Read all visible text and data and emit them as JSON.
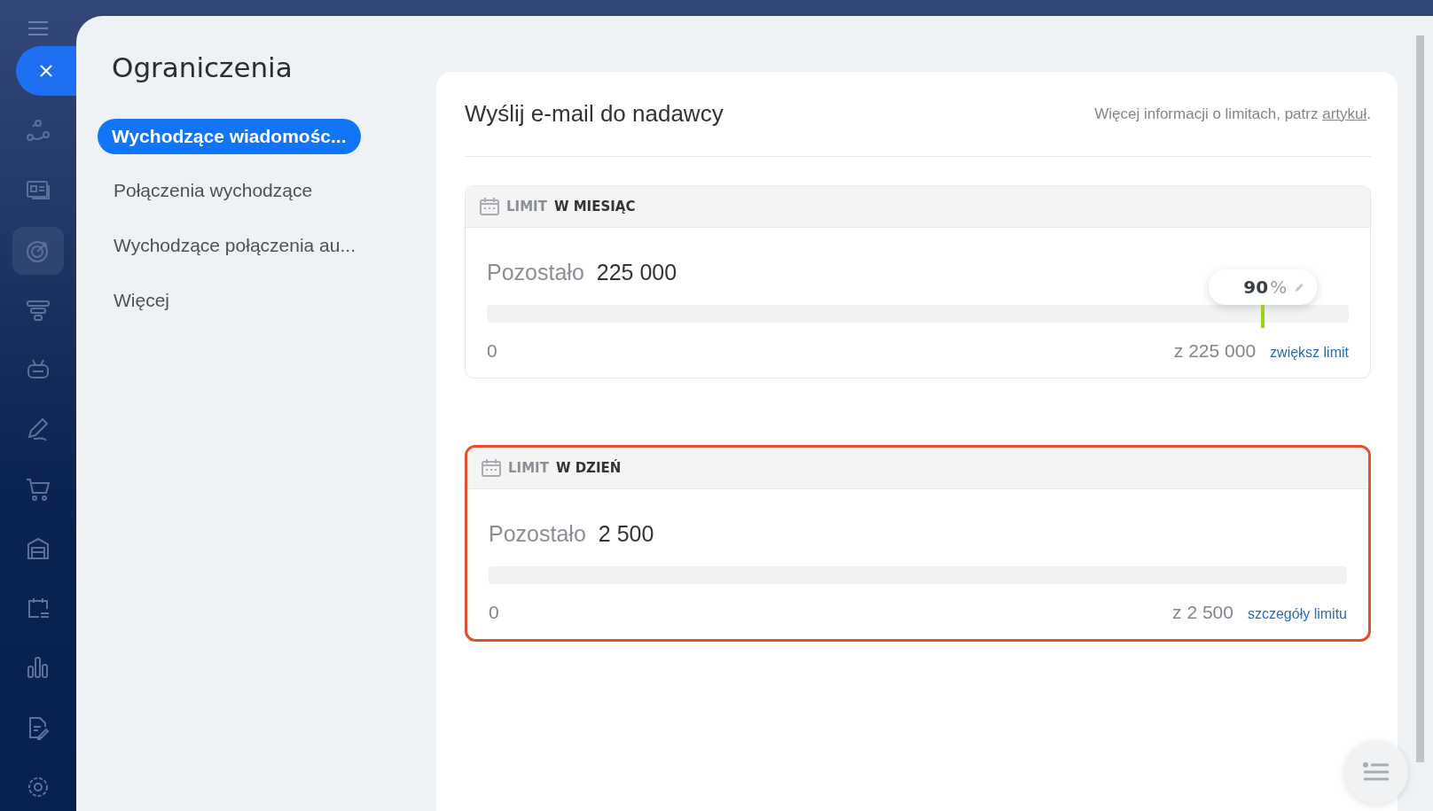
{
  "rail": {
    "icons": [
      {
        "kind": "menu",
        "selected": false
      },
      {
        "kind": "nodes",
        "selected": false
      },
      {
        "kind": "card",
        "selected": false
      },
      {
        "kind": "target",
        "selected": true
      },
      {
        "kind": "funnel",
        "selected": false
      },
      {
        "kind": "robot",
        "selected": false
      },
      {
        "kind": "pen",
        "selected": false
      },
      {
        "kind": "cart",
        "selected": false
      },
      {
        "kind": "garage",
        "selected": false
      },
      {
        "kind": "calendar",
        "selected": false
      },
      {
        "kind": "bars",
        "selected": false
      },
      {
        "kind": "doc",
        "selected": false
      },
      {
        "kind": "gear",
        "selected": false
      }
    ]
  },
  "panel": {
    "title": "Ograniczenia",
    "nav": [
      {
        "label": "Wychodzące wiadomośc...",
        "selected": true
      },
      {
        "label": "Połączenia wychodzące",
        "selected": false
      },
      {
        "label": "Wychodzące połączenia au...",
        "selected": false
      },
      {
        "label": "Więcej",
        "selected": false
      }
    ]
  },
  "content": {
    "title": "Wyślij e-mail do nadawcy",
    "info": "Więcej informacji o limitach, patrz",
    "info_link": "artykuł",
    "info_end": ".",
    "limits": [
      {
        "prefix": "LIMIT",
        "period": "W MIESIĄC",
        "highlighted": false,
        "remaining_label": "Pozostało",
        "remaining": "225 000",
        "min": "0",
        "max": "z 225 000",
        "link": "zwiększ limit",
        "threshold": {
          "level": 0.9,
          "value": "90",
          "unit": "%"
        }
      },
      {
        "prefix": "LIMIT",
        "period": "W DZIEŃ",
        "highlighted": true,
        "remaining_label": "Pozostało",
        "remaining": "2 500",
        "min": "0",
        "max": "z 2 500",
        "link": "szczegóły limitu"
      }
    ]
  }
}
